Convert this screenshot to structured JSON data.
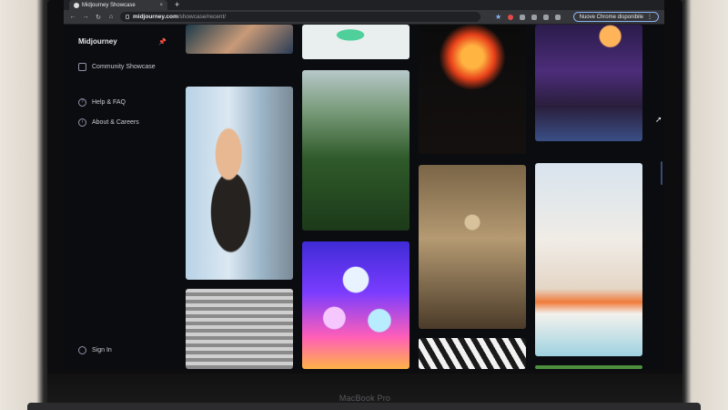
{
  "browser": {
    "tab_title": "Midjourney Showcase",
    "tab_close": "×",
    "new_tab": "+",
    "url_host": "midjourney.com",
    "url_path": "/showcase/recent/",
    "update_button": "Nuove Chrome disponibile",
    "update_menu": "⋮",
    "nav": {
      "back": "←",
      "forward": "→",
      "reload": "↻",
      "home": "⌂"
    },
    "star": "★"
  },
  "sidebar": {
    "brand": "Midjourney",
    "items": [
      {
        "label": "Community Showcase",
        "icon": "showcase-icon"
      },
      {
        "label": "Help & FAQ",
        "icon": "help-icon"
      },
      {
        "label": "About & Careers",
        "icon": "info-icon"
      },
      {
        "label": "Sign In",
        "icon": "user-icon"
      }
    ]
  },
  "gallery": {
    "images": [
      "portrait-cropped",
      "green-jelly-objects",
      "fire-rose",
      "haunted-house",
      "woman-by-window",
      "jungle-landscape",
      "misty-city-walkers",
      "modern-house-collage",
      "vintage-crowd-flag",
      "neon-ghosts",
      "white-wave-pattern",
      "green-strip"
    ],
    "scroll_top_label": "↑"
  },
  "device": {
    "label": "MacBook Pro"
  }
}
